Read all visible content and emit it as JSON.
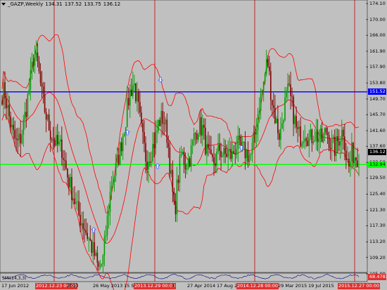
{
  "window": {
    "symbol": "_GAZP,Weekly",
    "open": "134.31",
    "high": "137.52",
    "low": "133.75",
    "close": "136.12"
  },
  "indicator": {
    "label": "SMI(14,3,3)",
    "value": "68.4783"
  },
  "price_axis": [
    "174.10",
    "170.00",
    "166.00",
    "161.90",
    "157.90",
    "153.80",
    "149.70",
    "145.70",
    "141.60",
    "137.60",
    "133.50",
    "129.50",
    "125.40",
    "121.30",
    "117.30",
    "113.20",
    "109.20",
    "105.00"
  ],
  "horizontal_levels": {
    "blue": "151.52",
    "green": "132.94",
    "current": "136.12"
  },
  "time_axis": [
    {
      "text": "17 Jun 2012",
      "highlight": false
    },
    {
      "text": "2012.12.23 00:00",
      "highlight": true
    },
    {
      "text": "2013",
      "highlight": false
    },
    {
      "text": "26 May 2013",
      "highlight": false
    },
    {
      "text": "15 Se",
      "highlight": false
    },
    {
      "text": "2013.12.29 00:00",
      "highlight": true
    },
    {
      "text": "4",
      "highlight": false
    },
    {
      "text": "27 Apr 2014",
      "highlight": false
    },
    {
      "text": "17 Aug 2",
      "highlight": false
    },
    {
      "text": "2014.12.28 00:00",
      "highlight": true
    },
    {
      "text": "29 Mar 2015",
      "highlight": false
    },
    {
      "text": "19 Jul 2015",
      "highlight": false
    },
    {
      "text": "2015.12.27 00:00",
      "highlight": true
    }
  ],
  "colors": {
    "background": "#c0c0c0",
    "bull": "#00a000",
    "bear": "#800000",
    "bands": "#ff0000",
    "blue_line": "#0000ff",
    "green_line": "#00ff00",
    "separator": "#c00000",
    "arrow": "#4060ff"
  },
  "chart_data": {
    "type": "candlestick",
    "y_range": [
      105.0,
      174.1
    ],
    "levels": {
      "blue": 151.52,
      "green": 132.94
    },
    "keypoints": [
      [
        0,
        150
      ],
      [
        6,
        152
      ],
      [
        12,
        146
      ],
      [
        18,
        141
      ],
      [
        24,
        138
      ],
      [
        30,
        140
      ],
      [
        36,
        146
      ],
      [
        42,
        153
      ],
      [
        48,
        161
      ],
      [
        54,
        158
      ],
      [
        60,
        150
      ],
      [
        66,
        145
      ],
      [
        72,
        141
      ],
      [
        80,
        138
      ],
      [
        88,
        137
      ],
      [
        96,
        130
      ],
      [
        104,
        125
      ],
      [
        112,
        120
      ],
      [
        120,
        117
      ],
      [
        128,
        113
      ],
      [
        134,
        110
      ],
      [
        140,
        106
      ],
      [
        146,
        108
      ],
      [
        152,
        118
      ],
      [
        158,
        128
      ],
      [
        165,
        132
      ],
      [
        172,
        138
      ],
      [
        178,
        144
      ],
      [
        184,
        151
      ],
      [
        190,
        154
      ],
      [
        196,
        148
      ],
      [
        202,
        140
      ],
      [
        208,
        134
      ],
      [
        214,
        136
      ],
      [
        220,
        139
      ],
      [
        226,
        144
      ],
      [
        232,
        145
      ],
      [
        238,
        140
      ],
      [
        244,
        128
      ],
      [
        248,
        120
      ],
      [
        252,
        128
      ],
      [
        258,
        136
      ],
      [
        264,
        133
      ],
      [
        270,
        135
      ],
      [
        276,
        140
      ],
      [
        282,
        143
      ],
      [
        288,
        142
      ],
      [
        294,
        136
      ],
      [
        300,
        133
      ],
      [
        306,
        134
      ],
      [
        312,
        137
      ],
      [
        318,
        135
      ],
      [
        324,
        136
      ],
      [
        330,
        135
      ],
      [
        336,
        138
      ],
      [
        342,
        137
      ],
      [
        350,
        136
      ],
      [
        356,
        135
      ],
      [
        362,
        140
      ],
      [
        368,
        148
      ],
      [
        374,
        153
      ],
      [
        380,
        160
      ],
      [
        386,
        150
      ],
      [
        392,
        144
      ],
      [
        398,
        140
      ],
      [
        404,
        148
      ],
      [
        410,
        152
      ],
      [
        416,
        147
      ],
      [
        422,
        141
      ],
      [
        428,
        140
      ],
      [
        434,
        142
      ],
      [
        440,
        139
      ],
      [
        446,
        141
      ],
      [
        452,
        140
      ],
      [
        458,
        139
      ],
      [
        464,
        142
      ],
      [
        470,
        138
      ],
      [
        476,
        137
      ],
      [
        482,
        140
      ],
      [
        488,
        142
      ],
      [
        492,
        135
      ],
      [
        496,
        132
      ],
      [
        500,
        136
      ],
      [
        505,
        135
      ]
    ]
  }
}
